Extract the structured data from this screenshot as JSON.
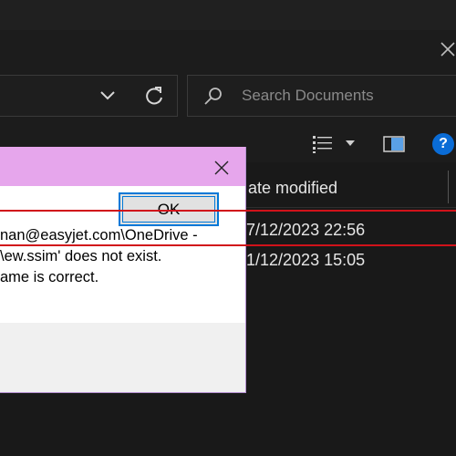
{
  "search": {
    "placeholder": "Search Documents"
  },
  "toolbar": {
    "view_icon": "details-view-icon",
    "pane_icon": "preview-pane-icon",
    "help_label": "?"
  },
  "columns": {
    "date_modified": "ate modified"
  },
  "rows": [
    {
      "date": "7/12/2023 22:56",
      "highlighted": true
    },
    {
      "date": "1/12/2023 15:05",
      "highlighted": false
    }
  ],
  "dialog": {
    "message_lines": [
      "nan@easyjet.com\\OneDrive -",
      "\\ew.ssim' does not exist.",
      "ame is correct."
    ],
    "ok_label": "OK",
    "colors": {
      "titlebar": "#e6a6ec",
      "ok_border": "#0078d7"
    }
  },
  "annotation": {
    "highlight_color": "#d1121a"
  }
}
